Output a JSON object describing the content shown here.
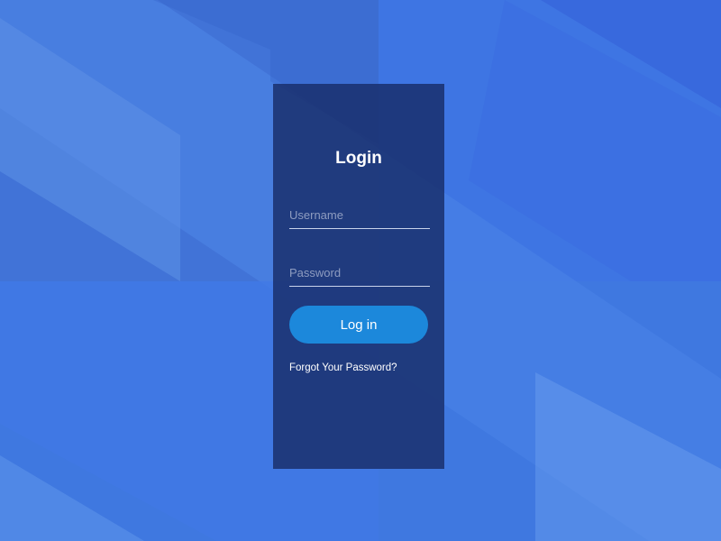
{
  "colors": {
    "background": "#3f78e0",
    "panel": "#1a306e",
    "button": "#1c88db",
    "text": "#ffffff",
    "placeholder": "#8e9cc0",
    "underline": "#c9d3ea"
  },
  "login": {
    "title": "Login",
    "username_placeholder": "Username",
    "password_placeholder": "Password",
    "button_label": "Log in",
    "forgot_link": "Forgot Your Password?"
  }
}
